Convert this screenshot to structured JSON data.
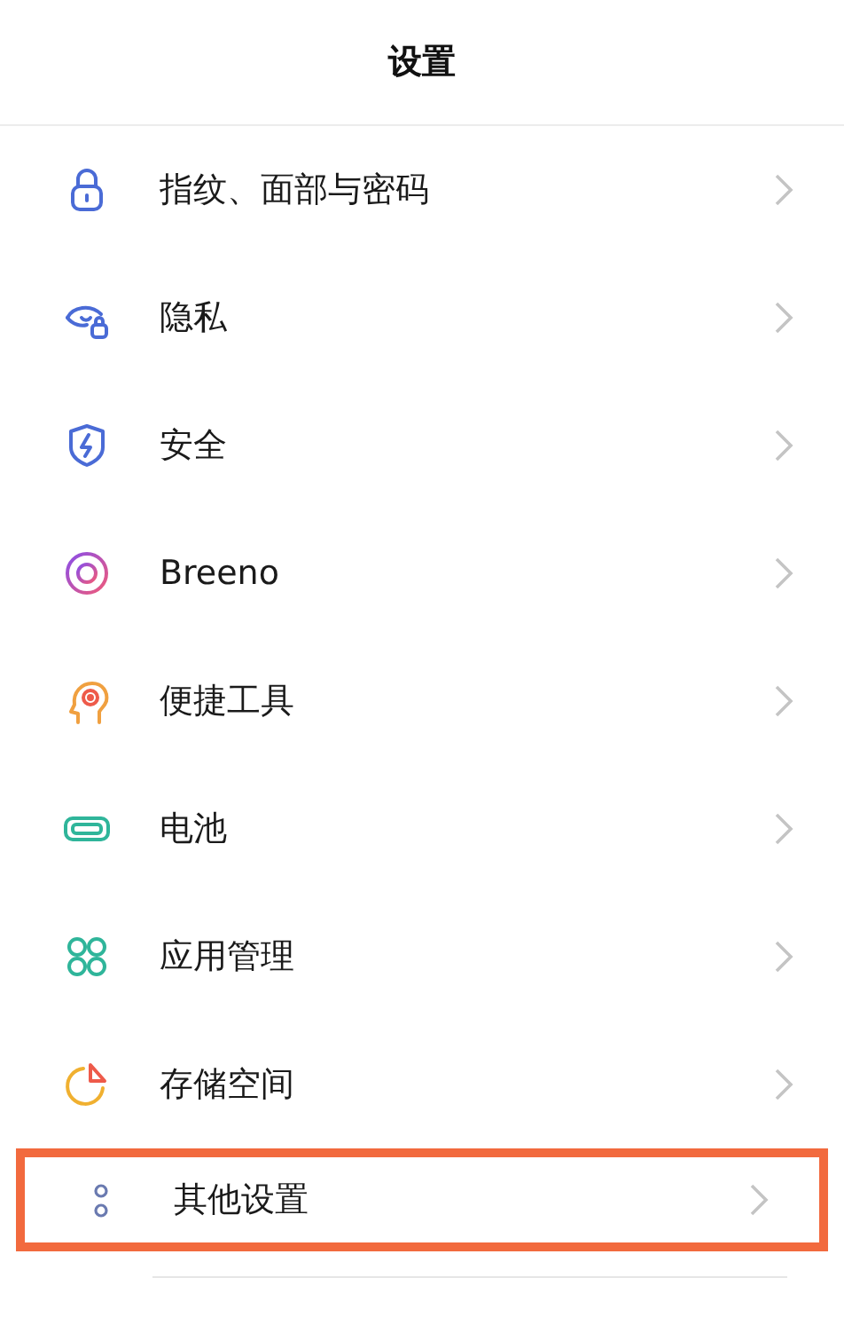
{
  "header": {
    "title": "设置"
  },
  "items": [
    {
      "label": "指纹、面部与密码",
      "highlighted": false
    },
    {
      "label": "隐私",
      "highlighted": false
    },
    {
      "label": "安全",
      "highlighted": false
    },
    {
      "label": "Breeno",
      "highlighted": false
    },
    {
      "label": "便捷工具",
      "highlighted": false
    },
    {
      "label": "电池",
      "highlighted": false
    },
    {
      "label": "应用管理",
      "highlighted": false
    },
    {
      "label": "存储空间",
      "highlighted": false
    },
    {
      "label": "其他设置",
      "highlighted": true
    }
  ]
}
